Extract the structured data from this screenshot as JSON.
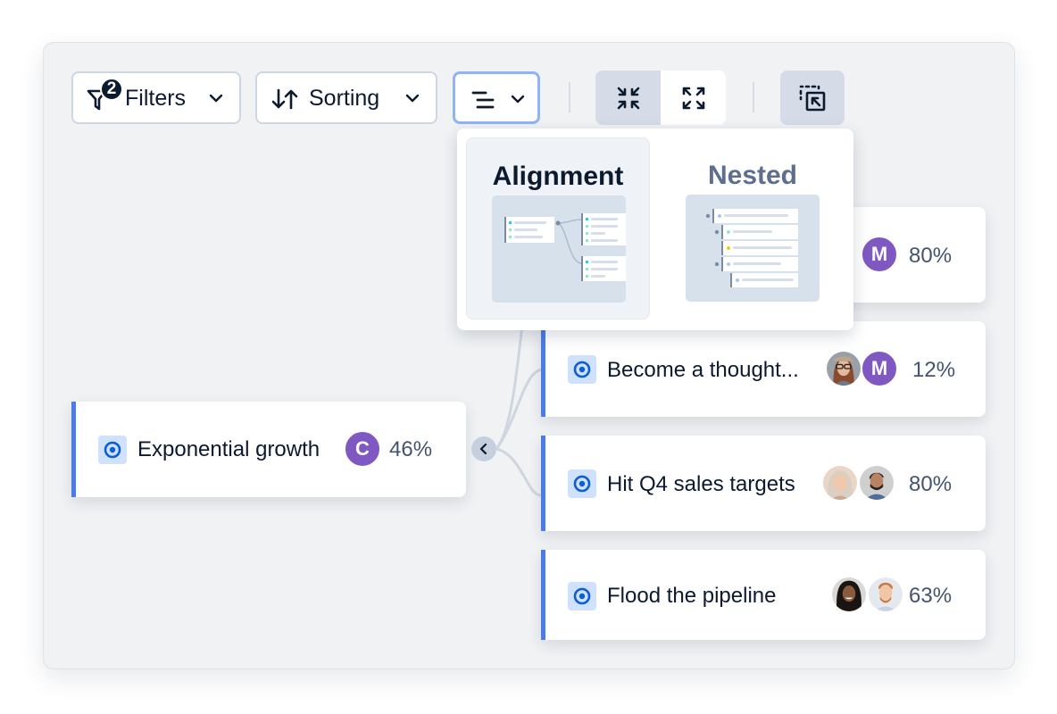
{
  "toolbar": {
    "filters": {
      "label": "Filters",
      "badge_count": "2",
      "icon": "filter-icon"
    },
    "sorting": {
      "label": "Sorting",
      "icon": "sort-arrows-icon"
    },
    "layout_menu": {
      "icon": "layout-lines-icon",
      "expanded": true
    },
    "view_toggle": {
      "collapse_all_icon": "collapse-all-icon",
      "expand_all_icon": "expand-all-icon",
      "active": "collapse"
    },
    "export_icon": "export-selection-icon"
  },
  "layout_dropdown": {
    "options": [
      {
        "label": "Alignment",
        "selected": true
      },
      {
        "label": "Nested",
        "selected": false
      }
    ]
  },
  "colors": {
    "accent": "#4a7ce8",
    "avatar_purple": "#8058c2",
    "target_icon_bg": "#cfe1fb",
    "target_icon_fg": "#0b5ed7",
    "percent_text": "#44546f"
  },
  "goals": {
    "parent": {
      "title": "Exponential growth",
      "owners": [
        {
          "type": "initial",
          "initial": "C"
        }
      ],
      "progress": "46%"
    },
    "children": [
      {
        "title": "",
        "owners": [
          {
            "type": "initial",
            "initial": "M"
          }
        ],
        "progress": "80%"
      },
      {
        "title": "Become a thought...",
        "owners": [
          {
            "type": "photo",
            "desc": "woman-with-glasses"
          },
          {
            "type": "initial",
            "initial": "M"
          }
        ],
        "progress": "12%"
      },
      {
        "title": "Hit Q4 sales targets",
        "owners": [
          {
            "type": "photo",
            "desc": "older-woman"
          },
          {
            "type": "photo",
            "desc": "man-with-beard"
          }
        ],
        "progress": "80%"
      },
      {
        "title": "Flood the pipeline",
        "owners": [
          {
            "type": "photo",
            "desc": "woman-smiling"
          },
          {
            "type": "photo",
            "desc": "red-haired-man"
          }
        ],
        "progress": "63%"
      }
    ]
  }
}
